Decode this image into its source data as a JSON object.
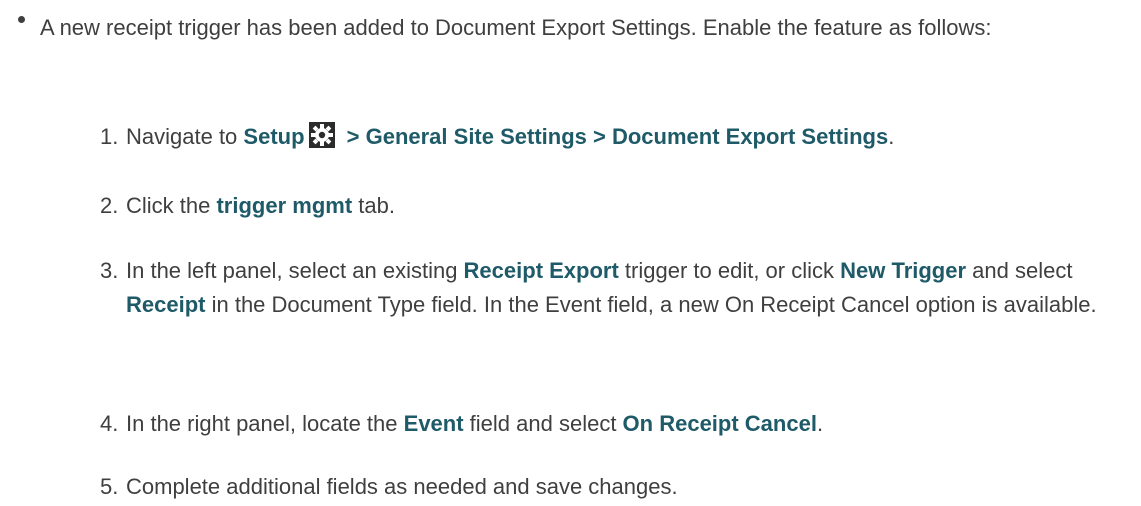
{
  "bullet": {
    "intro": "A new receipt trigger has been added to Document Export Settings. Enable the feature as follows:"
  },
  "steps": [
    {
      "num": "1.",
      "t1": "Navigate to ",
      "b1": "Setup",
      "icon": "gear-icon",
      "b2": " > General Site Settings > Document Export Settings",
      "t2": "."
    },
    {
      "num": "2.",
      "t1": "Click the ",
      "b1": "trigger mgmt",
      "t2": " tab."
    },
    {
      "num": "3.",
      "t1": "In the left panel, select an existing ",
      "b1": "Receipt Export",
      "t2": " trigger to edit, or click ",
      "b2": "New Trigger",
      "t3": " and select ",
      "b3": "Receipt",
      "t4": " in the Document Type field. In the Event field, a new On Receipt Cancel option is available."
    },
    {
      "num": "4.",
      "t1": "In the right panel, locate the ",
      "b1": "Event",
      "t2": " field and select ",
      "b2": "On Receipt Cancel",
      "t3": "."
    },
    {
      "num": "5.",
      "t1": "Complete additional fields as needed and save changes."
    }
  ]
}
